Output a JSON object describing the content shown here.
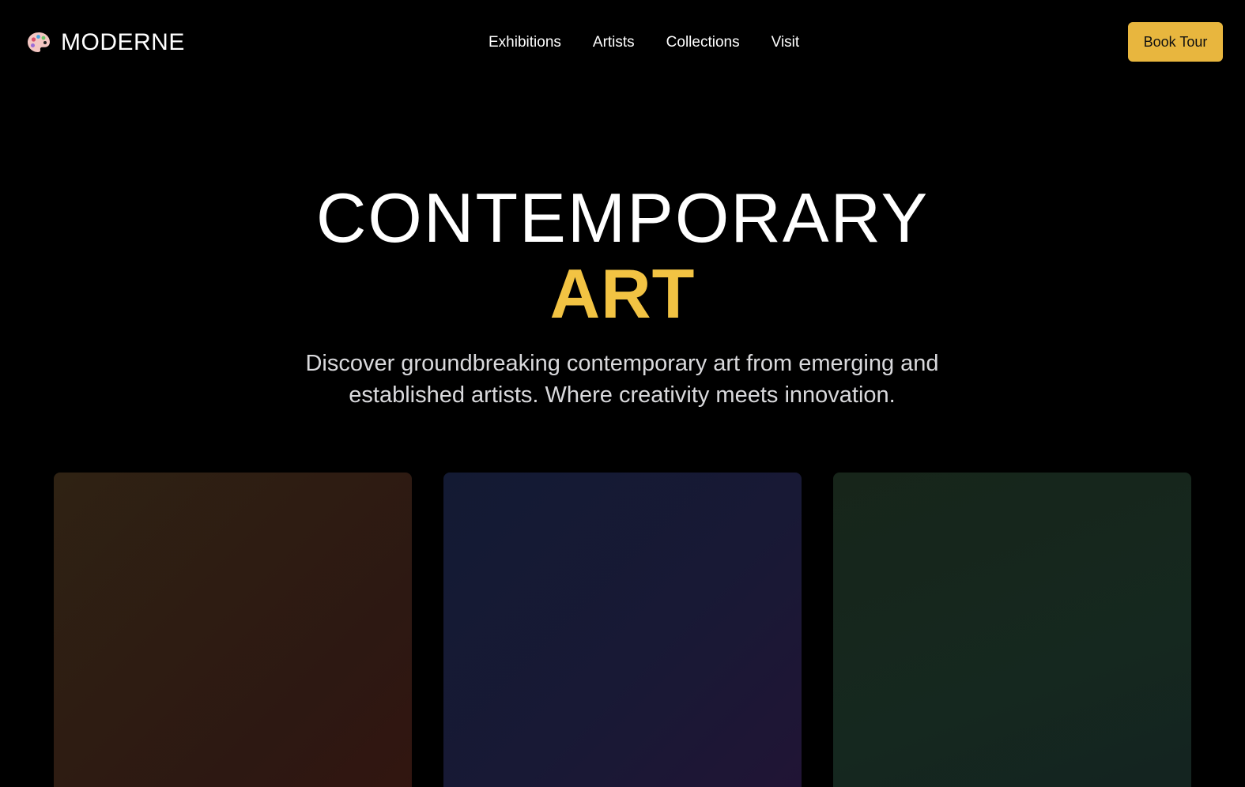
{
  "nav": {
    "brand": {
      "name": "MODERNE",
      "icon": "palette-icon"
    },
    "links": [
      "Exhibitions",
      "Artists",
      "Collections",
      "Visit"
    ],
    "cta_label": "Book Tour"
  },
  "hero": {
    "title_line1": "CONTEMPORARY",
    "title_line2": "ART",
    "subtitle": "Discover groundbreaking contemporary art from emerging and established artists. Where creativity meets innovation."
  },
  "colors": {
    "background": "#000000",
    "accent": "#f2c343",
    "button": "#e8b63e",
    "text": "#ffffff",
    "muted_text": "#d9d9dc"
  },
  "cards": [
    {
      "name": "artwork-card-warm",
      "gradient": [
        "#2f2213",
        "#321510"
      ]
    },
    {
      "name": "artwork-card-indigo",
      "gradient": [
        "#131a33",
        "#211435"
      ]
    },
    {
      "name": "artwork-card-green",
      "gradient": [
        "#17251a",
        "#142320"
      ]
    }
  ]
}
